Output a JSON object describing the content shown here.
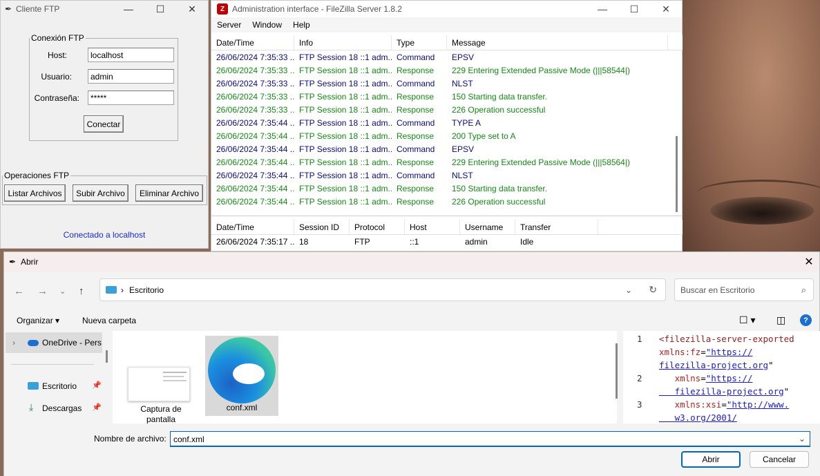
{
  "ftp_client": {
    "title": "Cliente FTP",
    "connection_group": "Conexión FTP",
    "host_label": "Host:",
    "host_value": "localhost",
    "user_label": "Usuario:",
    "user_value": "admin",
    "password_label": "Contraseña:",
    "password_value": "*****",
    "connect_button": "Conectar",
    "operations_group": "Operaciones FTP",
    "list_button": "Listar Archivos",
    "upload_button": "Subir Archivo",
    "delete_button": "Eliminar Archivo",
    "status": "Conectado a localhost"
  },
  "filezilla": {
    "title": "Administration interface - FileZilla Server 1.8.2",
    "menu": [
      "Server",
      "Window",
      "Help"
    ],
    "log_headers": [
      "Date/Time",
      "Info",
      "Type",
      "Message"
    ],
    "log_rows": [
      {
        "date": "26/06/2024 7:35:33 ...",
        "info": "FTP Session 18 ::1 adm...",
        "type": "Command",
        "message": "EPSV"
      },
      {
        "date": "26/06/2024 7:35:33 ...",
        "info": "FTP Session 18 ::1 adm...",
        "type": "Response",
        "message": "229 Entering Extended Passive Mode (|||58544|)"
      },
      {
        "date": "26/06/2024 7:35:33 ...",
        "info": "FTP Session 18 ::1 adm...",
        "type": "Command",
        "message": "NLST"
      },
      {
        "date": "26/06/2024 7:35:33 ...",
        "info": "FTP Session 18 ::1 adm...",
        "type": "Response",
        "message": "150 Starting data transfer."
      },
      {
        "date": "26/06/2024 7:35:33 ...",
        "info": "FTP Session 18 ::1 adm...",
        "type": "Response",
        "message": "226 Operation successful"
      },
      {
        "date": "26/06/2024 7:35:44 ...",
        "info": "FTP Session 18 ::1 adm...",
        "type": "Command",
        "message": "TYPE A"
      },
      {
        "date": "26/06/2024 7:35:44 ...",
        "info": "FTP Session 18 ::1 adm...",
        "type": "Response",
        "message": "200 Type set to A"
      },
      {
        "date": "26/06/2024 7:35:44 ...",
        "info": "FTP Session 18 ::1 adm...",
        "type": "Command",
        "message": "EPSV"
      },
      {
        "date": "26/06/2024 7:35:44 ...",
        "info": "FTP Session 18 ::1 adm...",
        "type": "Response",
        "message": "229 Entering Extended Passive Mode (|||58564|)"
      },
      {
        "date": "26/06/2024 7:35:44 ...",
        "info": "FTP Session 18 ::1 adm...",
        "type": "Command",
        "message": "NLST"
      },
      {
        "date": "26/06/2024 7:35:44 ...",
        "info": "FTP Session 18 ::1 adm...",
        "type": "Response",
        "message": "150 Starting data transfer."
      },
      {
        "date": "26/06/2024 7:35:44 ...",
        "info": "FTP Session 18 ::1 adm...",
        "type": "Response",
        "message": "226 Operation successful"
      }
    ],
    "session_headers": [
      "Date/Time",
      "Session ID",
      "Protocol",
      "Host",
      "Username",
      "Transfer"
    ],
    "session_rows": [
      {
        "date": "26/06/2024 7:35:17 ...",
        "id": "18",
        "protocol": "FTP",
        "host": "::1",
        "username": "admin",
        "transfer": "Idle"
      }
    ]
  },
  "open_dialog": {
    "title": "Abrir",
    "breadcrumb": "Escritorio",
    "search_placeholder": "Buscar en Escritorio",
    "organize": "Organizar",
    "new_folder": "Nueva carpeta",
    "nav_items": [
      "OneDrive - Perso",
      "Escritorio",
      "Descargas"
    ],
    "files": [
      {
        "name": "Captura de pantalla",
        "icon": "screenshot-thumbnail"
      },
      {
        "name": "conf.xml",
        "icon": "edge-icon"
      }
    ],
    "preview_lines": [
      {
        "num": "1",
        "parts": [
          [
            "tag",
            "<filezilla-server-exported"
          ]
        ]
      },
      {
        "num": "",
        "parts": [
          [
            "attr",
            "xmlns:fz"
          ],
          [
            "plain",
            "="
          ],
          [
            "str",
            "\"https://"
          ]
        ]
      },
      {
        "num": "",
        "parts": [
          [
            "str",
            "filezilla-project.org"
          ],
          [
            "plain",
            "\""
          ]
        ]
      },
      {
        "num": "2",
        "parts": [
          [
            "attr",
            "   xmlns"
          ],
          [
            "plain",
            "="
          ],
          [
            "str",
            "\"https://"
          ]
        ]
      },
      {
        "num": "",
        "parts": [
          [
            "str",
            "   filezilla-project.org"
          ],
          [
            "plain",
            "\""
          ]
        ]
      },
      {
        "num": "3",
        "parts": [
          [
            "attr",
            "   xmlns:xsi"
          ],
          [
            "plain",
            "="
          ],
          [
            "str",
            "\"http://www."
          ]
        ]
      },
      {
        "num": "",
        "parts": [
          [
            "str",
            "   w3.org/2001/"
          ]
        ]
      }
    ],
    "filename_label": "Nombre de archivo:",
    "filename_value": "conf.xml",
    "open_button": "Abrir",
    "cancel_button": "Cancelar"
  },
  "colors": {
    "command": "#0a0a85",
    "response": "#148a14",
    "accent": "#0067c0",
    "status_link": "#1a2bd6"
  }
}
